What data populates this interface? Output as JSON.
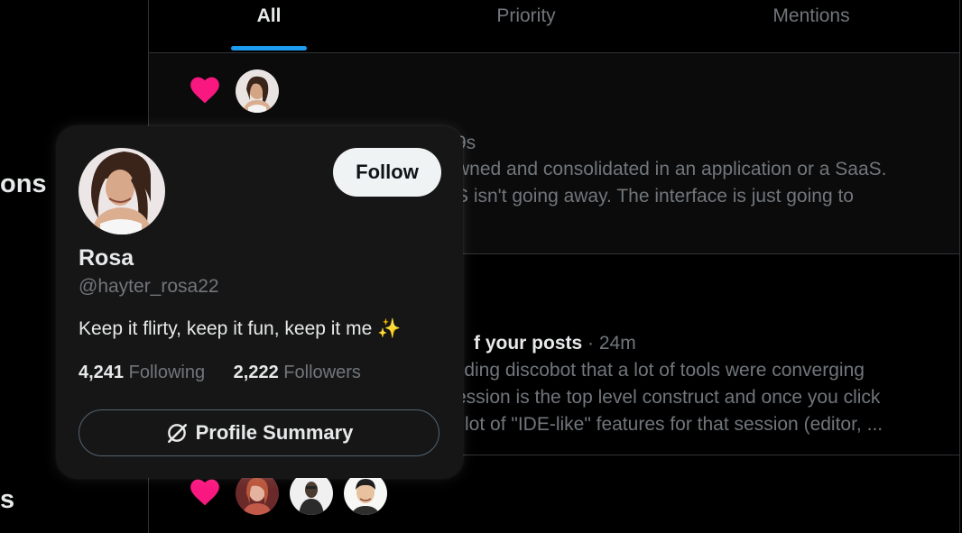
{
  "nav": {
    "fragments": [
      "ons",
      "s"
    ]
  },
  "tabs": [
    {
      "label": "All",
      "active": true
    },
    {
      "label": "Priority",
      "active": false
    },
    {
      "label": "Mentions",
      "active": false
    }
  ],
  "notifications": [
    {
      "type": "like",
      "time_fragment": "9s",
      "body_lines": [
        "wned and consolidated in an application or a SaaS.",
        "S isn't going away. The interface is just going to"
      ]
    },
    {
      "type": "like",
      "title_fragment": "f your posts",
      "time": "24m",
      "body_lines": [
        "ilding discobot that a lot of tools were converging",
        "ession is the top level construct and once you click",
        "lot of \"IDE-like\" features for that session (editor, ..."
      ]
    },
    {
      "type": "like"
    }
  ],
  "hovercard": {
    "name": "Rosa",
    "handle": "@hayter_rosa22",
    "bio": "Keep it flirty, keep it fun, keep it me ✨",
    "follow_label": "Follow",
    "following_count": "4,241",
    "following_label": "Following",
    "followers_count": "2,222",
    "followers_label": "Followers",
    "summary_label": "Profile Summary"
  },
  "colors": {
    "like": "#f91880",
    "accent": "#1d9bf0",
    "card_bg": "#161616",
    "muted": "#71767b"
  },
  "icons": {
    "like": "heart-icon",
    "summary": "grok-slash-icon"
  }
}
